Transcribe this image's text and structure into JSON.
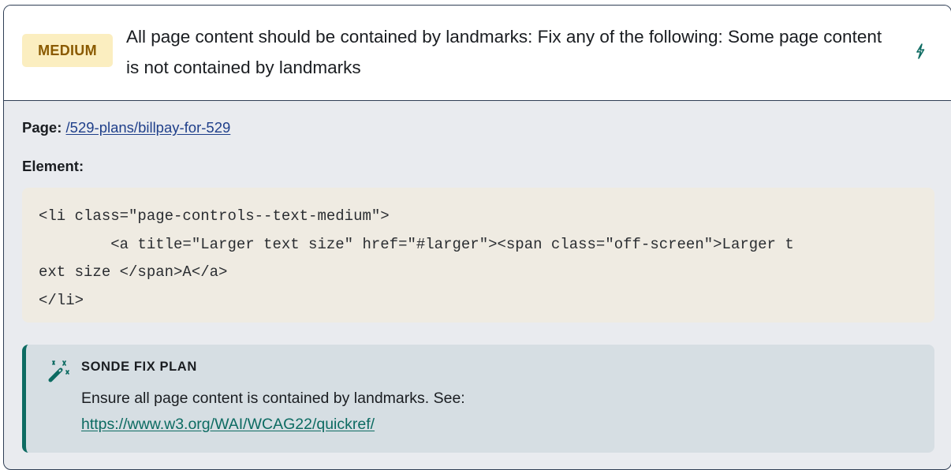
{
  "issue": {
    "severity": "MEDIUM",
    "title": "All page content should be contained by landmarks: Fix any of the following: Some page content is not contained by landmarks",
    "action_icon": "lightning-bolt-icon"
  },
  "details": {
    "page_label": "Page:",
    "page_url": "/529-plans/billpay-for-529",
    "element_label": "Element:",
    "code_lines": [
      "<li class=\"page-controls--text-medium\">",
      "        <a title=\"Larger text size\" href=\"#larger\"><span class=\"off-screen\">Larger t",
      "ext size </span>A</a>",
      "</li>"
    ]
  },
  "fix_plan": {
    "icon": "magic-wand-icon",
    "heading": "SONDE FIX PLAN",
    "text": "Ensure all page content is contained by landmarks. See:",
    "link": "https://www.w3.org/WAI/WCAG22/quickref/"
  },
  "colors": {
    "border": "#2f3e55",
    "badge_bg": "#fbeec0",
    "badge_text": "#8a5a00",
    "code_bg": "#efebe2",
    "fix_bg": "#d6dee3",
    "fix_accent": "#0d6b62",
    "link": "#1f3f8a"
  }
}
